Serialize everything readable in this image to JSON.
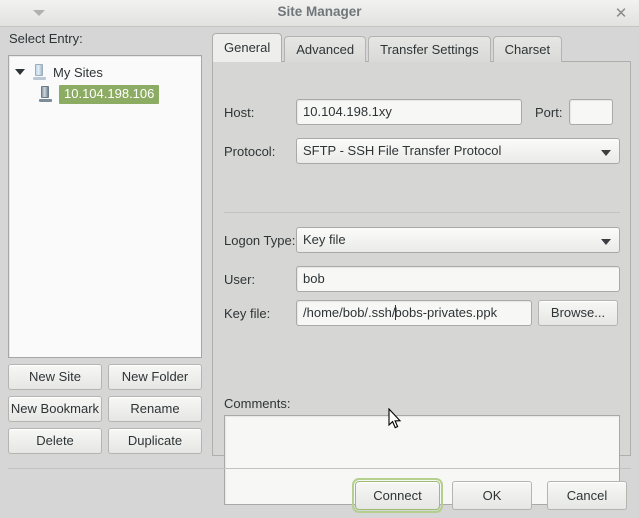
{
  "window": {
    "title": "Site Manager",
    "menu_icon": "caret-down-icon",
    "close_icon": "close-icon"
  },
  "sidebar": {
    "label": "Select Entry:",
    "tree": {
      "root": {
        "label": "My Sites",
        "icon": "server-icon",
        "expander": "expander-open-icon",
        "expanded": true
      },
      "children": [
        {
          "label": "10.104.198.106",
          "icon": "server-icon",
          "selected": true
        }
      ]
    },
    "buttons": [
      {
        "label": "New Site",
        "name": "new-site-button"
      },
      {
        "label": "New Folder",
        "name": "new-folder-button"
      },
      {
        "label": "New Bookmark",
        "name": "new-bookmark-button"
      },
      {
        "label": "Rename",
        "name": "rename-button"
      },
      {
        "label": "Delete",
        "name": "delete-button"
      },
      {
        "label": "Duplicate",
        "name": "duplicate-button"
      }
    ]
  },
  "tabs": [
    {
      "label": "General",
      "active": true
    },
    {
      "label": "Advanced",
      "active": false
    },
    {
      "label": "Transfer Settings",
      "active": false
    },
    {
      "label": "Charset",
      "active": false
    }
  ],
  "general": {
    "host": {
      "label": "Host:",
      "value": "10.104.198.1xy",
      "placeholder": ""
    },
    "port": {
      "label": "Port:",
      "value": "",
      "placeholder": ""
    },
    "protocol": {
      "label": "Protocol:",
      "value": "SFTP - SSH File Transfer Protocol",
      "arrow_icon": "chevron-down-icon"
    },
    "logon_type": {
      "label": "Logon Type:",
      "value": "Key file",
      "arrow_icon": "chevron-down-icon"
    },
    "user": {
      "label": "User:",
      "value": "bob",
      "placeholder": ""
    },
    "key_file": {
      "label": "Key file:",
      "value_before_caret": "/home/bob/.ssh/",
      "value_after_caret": "bobs-privates.ppk",
      "full_value": "/home/bob/.ssh/bobs-privates.ppk",
      "browse_label": "Browse..."
    },
    "comments": {
      "label": "Comments:",
      "value": "",
      "placeholder": ""
    }
  },
  "actions": [
    {
      "label": "Connect",
      "name": "connect-button",
      "focused": true
    },
    {
      "label": "OK",
      "name": "ok-button",
      "focused": false
    },
    {
      "label": "Cancel",
      "name": "cancel-button",
      "focused": false
    }
  ],
  "colors": {
    "selection": "#8cab63",
    "focus_ring": "#b5cf8e",
    "window_bg": "#d6d6d6",
    "panel_bg": "#d6d6d4",
    "field_bg": "#f7f7f6"
  }
}
